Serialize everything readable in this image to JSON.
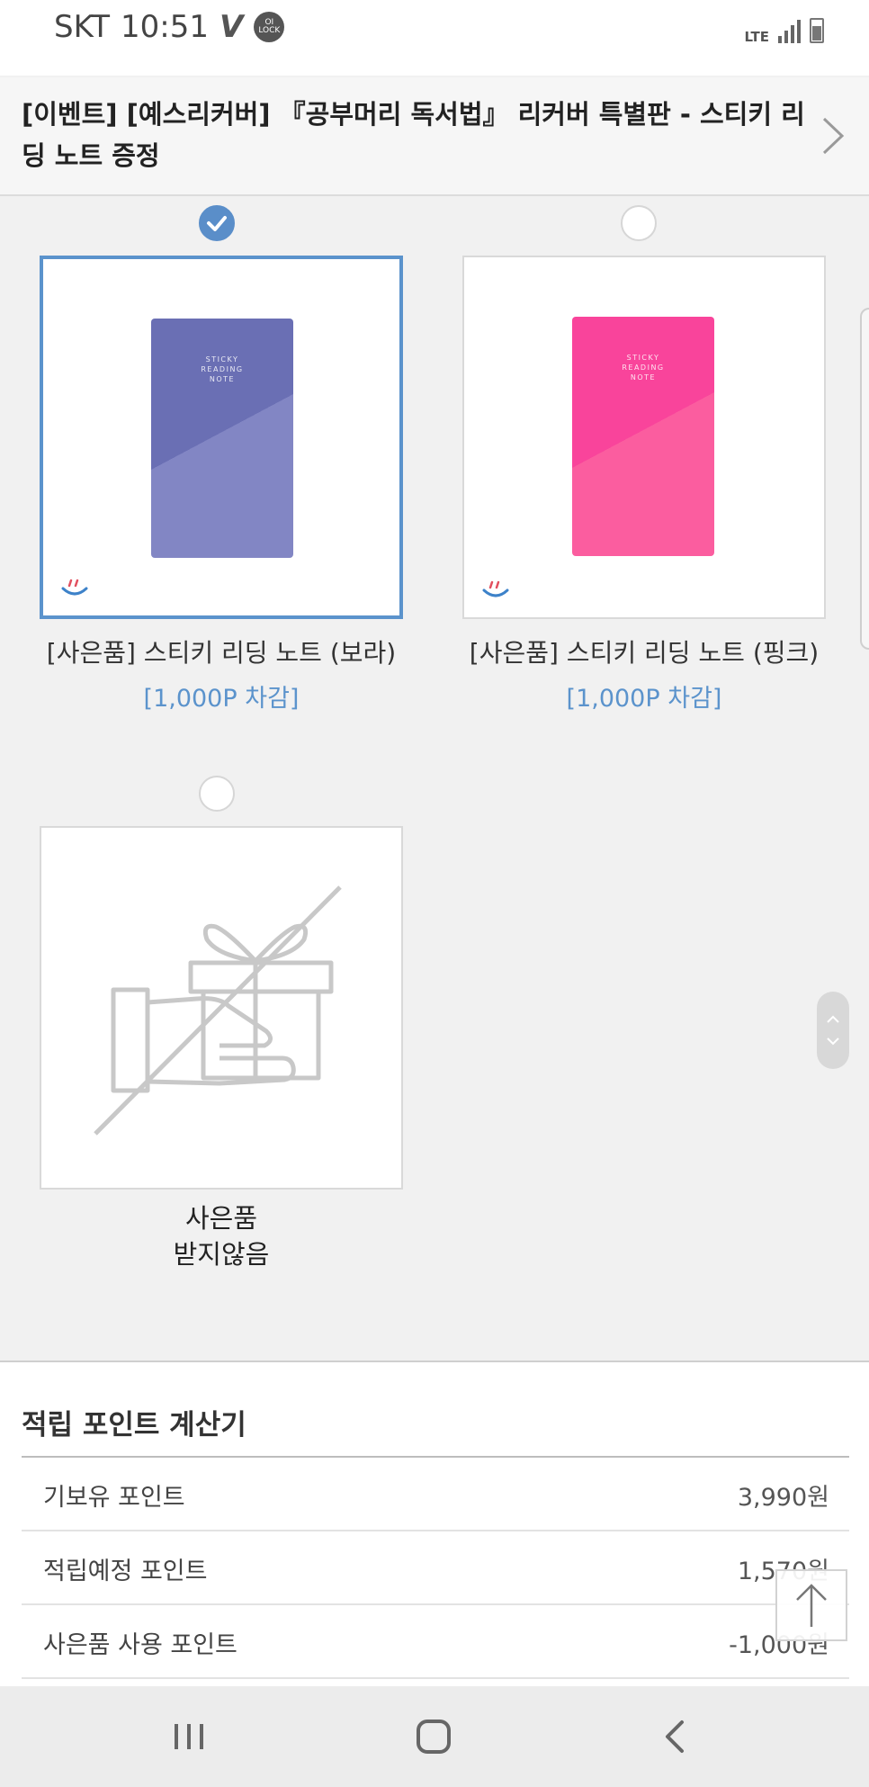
{
  "status_bar": {
    "carrier": "SKT",
    "time": "10:51",
    "lock_badge": "OI LOCK",
    "network": "LTE"
  },
  "header": {
    "title": "[이벤트] [예스리커버] 『공부머리 독서법』 리커버 특별판 - 스티키 리딩 노트 증정"
  },
  "gifts": [
    {
      "name": "[사은품] 스티키 리딩 노트 (보라)",
      "price": "[1,000P 차감]",
      "selected": true,
      "cover_color": "#7276b8",
      "cover_text": [
        "STICKY",
        "READING",
        "NOTE"
      ]
    },
    {
      "name": "[사은품] 스티키 리딩 노트 (핑크)",
      "price": "[1,000P 차감]",
      "selected": false,
      "cover_color": "#f64a93",
      "cover_text": [
        "STICKY",
        "READING",
        "NOTE"
      ]
    },
    {
      "name_line1": "사은품",
      "name_line2": "받지않음",
      "selected": false
    }
  ],
  "calculator": {
    "title": "적립 포인트 계산기",
    "rows": [
      {
        "label": "기보유 포인트",
        "value": "3,990원"
      },
      {
        "label": "적립예정 포인트",
        "value": "1,570원"
      },
      {
        "label": "사은품 사용 포인트",
        "value": "-1,000원"
      }
    ]
  },
  "colors": {
    "accent": "#5b93cc",
    "background": "#f1f1f1",
    "purple_note": "#7276b8",
    "pink_note": "#f64a93"
  },
  "icons": {
    "header_chevron": "chevron-right-icon",
    "top_button": "arrow-up-icon",
    "nav_recent": "recent-apps-icon",
    "nav_home": "home-icon",
    "nav_back": "back-icon"
  }
}
